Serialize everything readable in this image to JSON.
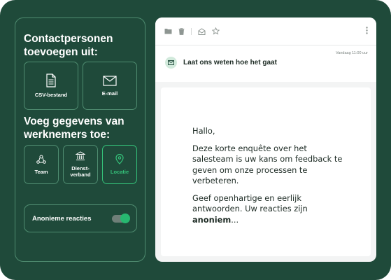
{
  "colors": {
    "background": "#1f4a3a",
    "border": "#4f8c70",
    "accent": "#35c27a",
    "toggle_on": "#27b870"
  },
  "left": {
    "heading_import": "Contactpersonen toevoegen uit:",
    "import_options": [
      {
        "label": "CSV-bestand",
        "icon": "csv-file-icon"
      },
      {
        "label": "E-mail",
        "icon": "envelope-icon"
      }
    ],
    "heading_employee": "Voeg gegevens van werknemers toe:",
    "employee_options": [
      {
        "label": "Team",
        "icon": "team-icon",
        "selected": false
      },
      {
        "label": "Dienst-verband",
        "icon": "building-icon",
        "selected": false
      },
      {
        "label": "Locatie",
        "icon": "location-pin-icon",
        "selected": true
      }
    ],
    "anonymous": {
      "label": "Anonieme reacties",
      "enabled": true
    }
  },
  "mail": {
    "toolbar_icons": [
      "folder-icon",
      "trash-icon",
      "archive-icon",
      "star-icon"
    ],
    "more_icon": "more-vertical-icon",
    "timestamp": "Vandaag 11:00 uur",
    "subject_icon": "envelope-icon",
    "subject": "Laat ons weten hoe het gaat",
    "greeting": "Hallo,",
    "paragraph1": "Deze korte enquête over het salesteam is uw kans om feedback te geven om onze processen te verbeteren.",
    "paragraph2_prefix": "Geef openhartige en eerlijk antwoorden. Uw reacties zijn ",
    "paragraph2_bold": "anoniem",
    "paragraph2_suffix": "..."
  }
}
